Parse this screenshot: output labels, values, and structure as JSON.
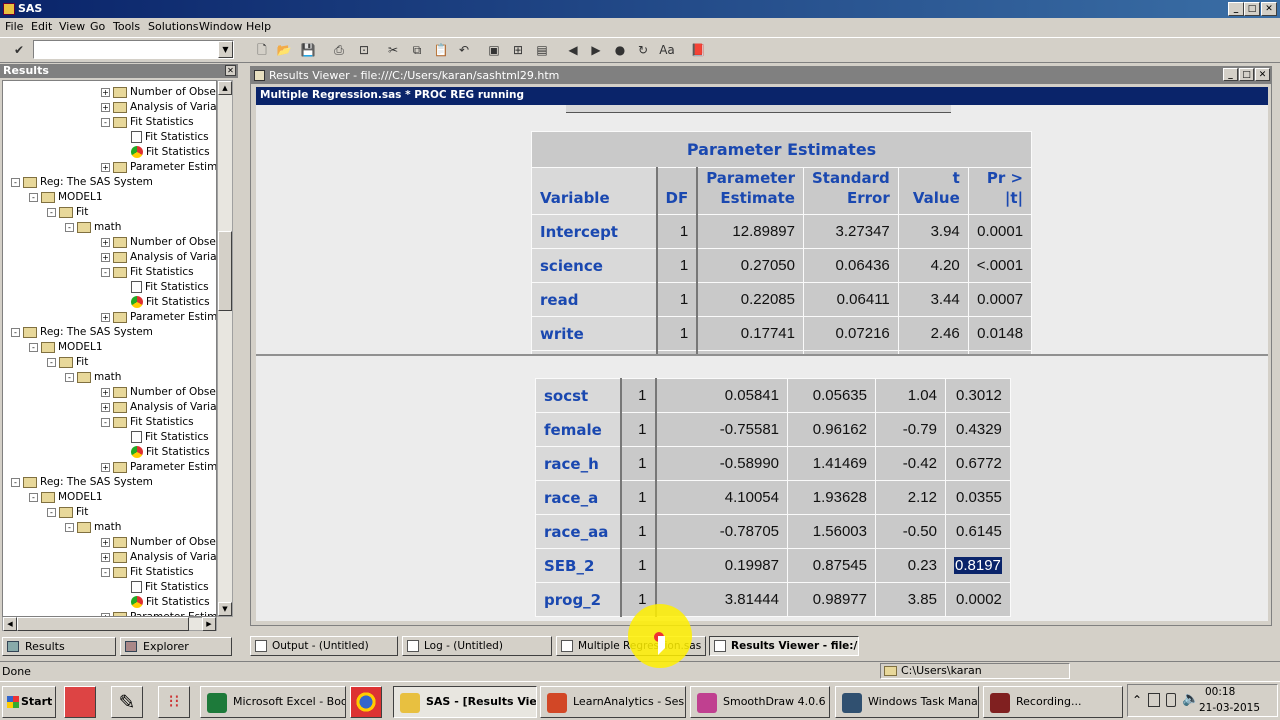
{
  "app": {
    "title": "SAS"
  },
  "menu": [
    "File",
    "Edit",
    "View",
    "Go",
    "Tools",
    "Solutions",
    "Window",
    "Help"
  ],
  "results_pane": {
    "title": "Results",
    "tree": [
      {
        "indent": 5,
        "label": "Number of Observatic",
        "kind": "folder",
        "box": "+"
      },
      {
        "indent": 5,
        "label": "Analysis of Variance",
        "kind": "folder",
        "box": "+"
      },
      {
        "indent": 5,
        "label": "Fit Statistics",
        "kind": "folder",
        "box": "-"
      },
      {
        "indent": 6,
        "label": "Fit Statistics",
        "kind": "doc",
        "box": ""
      },
      {
        "indent": 6,
        "label": "Fit Statistics",
        "kind": "chrome",
        "box": ""
      },
      {
        "indent": 5,
        "label": "Parameter Estimates",
        "kind": "folder",
        "box": "+"
      },
      {
        "indent": 0,
        "label": "Reg:  The SAS System",
        "kind": "folder",
        "box": "-"
      },
      {
        "indent": 1,
        "label": "MODEL1",
        "kind": "folder",
        "box": "-"
      },
      {
        "indent": 2,
        "label": "Fit",
        "kind": "folder",
        "box": "-"
      },
      {
        "indent": 3,
        "label": "math",
        "kind": "folder",
        "box": "-"
      },
      {
        "indent": 5,
        "label": "Number of Observatic",
        "kind": "folder",
        "box": "+"
      },
      {
        "indent": 5,
        "label": "Analysis of Variance",
        "kind": "folder",
        "box": "+"
      },
      {
        "indent": 5,
        "label": "Fit Statistics",
        "kind": "folder",
        "box": "-"
      },
      {
        "indent": 6,
        "label": "Fit Statistics",
        "kind": "doc",
        "box": ""
      },
      {
        "indent": 6,
        "label": "Fit Statistics",
        "kind": "chrome",
        "box": ""
      },
      {
        "indent": 5,
        "label": "Parameter Estimates",
        "kind": "folder",
        "box": "+"
      },
      {
        "indent": 0,
        "label": "Reg:  The SAS System",
        "kind": "folder",
        "box": "-"
      },
      {
        "indent": 1,
        "label": "MODEL1",
        "kind": "folder",
        "box": "-"
      },
      {
        "indent": 2,
        "label": "Fit",
        "kind": "folder",
        "box": "-"
      },
      {
        "indent": 3,
        "label": "math",
        "kind": "folder",
        "box": "-"
      },
      {
        "indent": 5,
        "label": "Number of Observatic",
        "kind": "folder",
        "box": "+"
      },
      {
        "indent": 5,
        "label": "Analysis of Variance",
        "kind": "folder",
        "box": "+"
      },
      {
        "indent": 5,
        "label": "Fit Statistics",
        "kind": "folder",
        "box": "-"
      },
      {
        "indent": 6,
        "label": "Fit Statistics",
        "kind": "doc",
        "box": ""
      },
      {
        "indent": 6,
        "label": "Fit Statistics",
        "kind": "chrome",
        "box": ""
      },
      {
        "indent": 5,
        "label": "Parameter Estimates",
        "kind": "folder",
        "box": "+"
      },
      {
        "indent": 0,
        "label": "Reg:  The SAS System",
        "kind": "folder",
        "box": "-"
      },
      {
        "indent": 1,
        "label": "MODEL1",
        "kind": "folder",
        "box": "-"
      },
      {
        "indent": 2,
        "label": "Fit",
        "kind": "folder",
        "box": "-"
      },
      {
        "indent": 3,
        "label": "math",
        "kind": "folder",
        "box": "-"
      },
      {
        "indent": 5,
        "label": "Number of Observatic",
        "kind": "folder",
        "box": "+"
      },
      {
        "indent": 5,
        "label": "Analysis of Variance",
        "kind": "folder",
        "box": "+"
      },
      {
        "indent": 5,
        "label": "Fit Statistics",
        "kind": "folder",
        "box": "-"
      },
      {
        "indent": 6,
        "label": "Fit Statistics",
        "kind": "doc",
        "box": ""
      },
      {
        "indent": 6,
        "label": "Fit Statistics",
        "kind": "chrome",
        "box": ""
      },
      {
        "indent": 5,
        "label": "Parameter Estimates",
        "kind": "folder",
        "box": "+"
      }
    ],
    "tabs": [
      "Results",
      "Explorer"
    ]
  },
  "viewer": {
    "title": "Results Viewer - file:///C:/Users/karan/sashtml29.htm",
    "task": "Multiple Regression.sas *   PROC REG running"
  },
  "table": {
    "caption": "Parameter Estimates",
    "headers": {
      "variable": "Variable",
      "df": "DF",
      "estimate_1": "Parameter",
      "estimate_2": "Estimate",
      "stderr_1": "Standard",
      "stderr_2": "Error",
      "tvalue": "t Value",
      "pr": "Pr > |t|"
    },
    "rows_top": [
      [
        "Intercept",
        "1",
        "12.89897",
        "3.27347",
        "3.94",
        "0.0001"
      ],
      [
        "science",
        "1",
        "0.27050",
        "0.06436",
        "4.20",
        "<.0001"
      ],
      [
        "read",
        "1",
        "0.22085",
        "0.06411",
        "3.44",
        "0.0007"
      ],
      [
        "write",
        "1",
        "0.17741",
        "0.07216",
        "2.46",
        "0.0148"
      ],
      [
        "socst",
        "1",
        "0.05841",
        "0.05635",
        "1.04",
        "0.3012"
      ]
    ],
    "rows_bottom": [
      [
        "socst",
        "1",
        "0.05841",
        "0.05635",
        "1.04",
        "0.3012"
      ],
      [
        "female",
        "1",
        "-0.75581",
        "0.96162",
        "-0.79",
        "0.4329"
      ],
      [
        "race_h",
        "1",
        "-0.58990",
        "1.41469",
        "-0.42",
        "0.6772"
      ],
      [
        "race_a",
        "1",
        "4.10054",
        "1.93628",
        "2.12",
        "0.0355"
      ],
      [
        "race_aa",
        "1",
        "-0.78705",
        "1.56003",
        "-0.50",
        "0.6145"
      ],
      [
        "SEB_2",
        "1",
        "0.19987",
        "0.87545",
        "0.23",
        "0.8197"
      ],
      [
        "prog_2",
        "1",
        "3.81444",
        "0.98977",
        "3.85",
        "0.0002"
      ]
    ],
    "selected_value": "0.8197"
  },
  "window_tabs": [
    {
      "label": "Output - (Untitled)",
      "active": false
    },
    {
      "label": "Log - (Untitled)",
      "active": false
    },
    {
      "label": "Multiple Regression.sas * ...",
      "active": false
    },
    {
      "label": "Results Viewer - file:/...",
      "active": true
    }
  ],
  "status": {
    "text": "Done",
    "path": "C:\\Users\\karan"
  },
  "taskbar": {
    "start": "Start",
    "items": [
      {
        "label": "Microsoft Excel - Book1",
        "color": "#1d7a3a",
        "active": false
      },
      {
        "label": "SAS - [Results Vie...",
        "color": "#e8c040",
        "active": true
      },
      {
        "label": "LearnAnalytics - Ses...",
        "color": "#d24726",
        "active": false
      },
      {
        "label": "SmoothDraw 4.0.6",
        "color": "#c04090",
        "active": false
      },
      {
        "label": "Windows Task Mana...",
        "color": "#305070",
        "active": false
      },
      {
        "label": "Recording...",
        "color": "#802020",
        "active": false
      }
    ],
    "clock_time": "00:18",
    "clock_date": "21-03-2015"
  }
}
